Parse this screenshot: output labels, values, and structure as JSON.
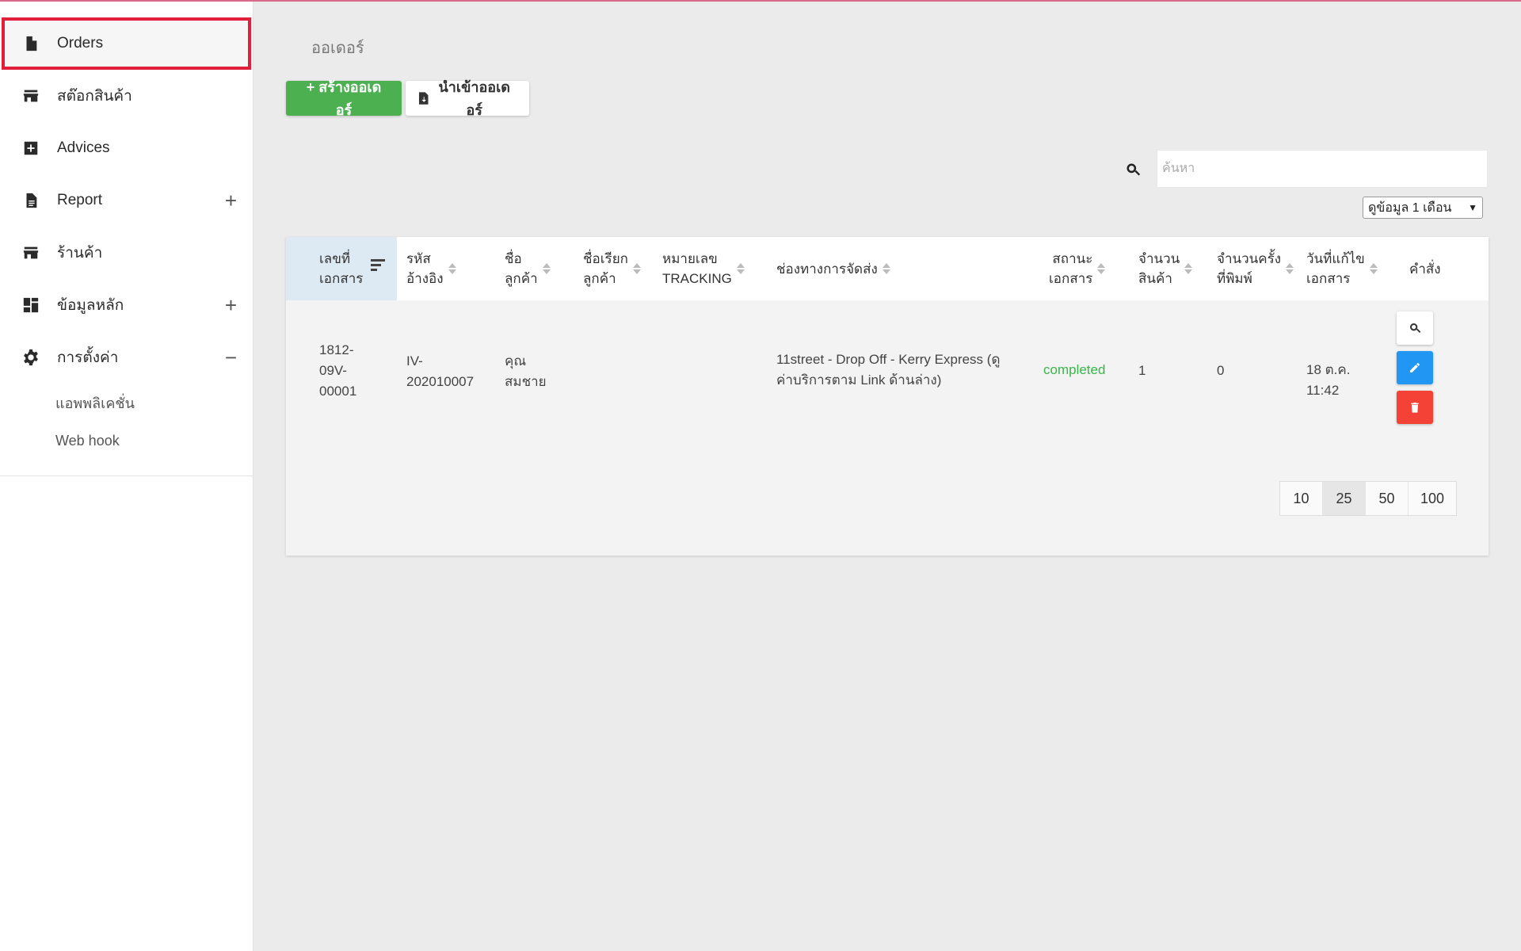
{
  "sidebar": {
    "items": [
      {
        "label": "Orders",
        "icon": "document-icon",
        "toggle": ""
      },
      {
        "label": "สต๊อกสินค้า",
        "icon": "store-icon",
        "toggle": ""
      },
      {
        "label": "Advices",
        "icon": "plus-box-icon",
        "toggle": ""
      },
      {
        "label": "Report",
        "icon": "report-icon",
        "toggle": "+"
      },
      {
        "label": "ร้านค้า",
        "icon": "store-icon",
        "toggle": ""
      },
      {
        "label": "ข้อมูลหลัก",
        "icon": "dashboard-icon",
        "toggle": "+"
      },
      {
        "label": "การตั้งค่า",
        "icon": "gear-icon",
        "toggle": "−"
      }
    ],
    "subitems": [
      {
        "label": "แอพพลิเคชั่น"
      },
      {
        "label": "Web hook"
      }
    ]
  },
  "main": {
    "title": "ออเดอร์",
    "create_button": "+ สร้างออเดอร์",
    "import_button": "นำเข้าออเดอร์",
    "search": {
      "placeholder": "ค้นหา",
      "value": ""
    },
    "range_select": "ดูข้อมูล 1 เดือน"
  },
  "table": {
    "headers": [
      "เลขที่\nเอกสาร",
      "รหัส\nอ้างอิง",
      "ชื่อ\nลูกค้า",
      "ชื่อเรียก\nลูกค้า",
      "หมายเลข\nTRACKING",
      "ช่องทางการจัดส่ง",
      "สถานะ\nเอกสาร",
      "จำนวน\nสินค้า",
      "จำนวนครั้ง\nที่พิมพ์",
      "วันที่แก้ไข\nเอกสาร",
      "คำสั่ง"
    ],
    "rows": [
      {
        "doc_no": "1812-\n09V-\n00001",
        "ref_code": "IV-\n202010007",
        "customer": "คุณ\nสมชาย",
        "nickname": "",
        "tracking": "",
        "shipping": "11street - Drop Off - Kerry Express (ดู\nค่าบริการตาม Link ด้านล่าง)",
        "status": "completed",
        "qty": "1",
        "print_count": "0",
        "modified": "18 ต.ค.\n11:42"
      }
    ],
    "page_sizes": [
      "10",
      "25",
      "50",
      "100"
    ],
    "active_page_size": "25"
  },
  "colors": {
    "create": "#4caf50",
    "edit": "#2196f3",
    "delete": "#f44336",
    "completed": "#39b54a",
    "highlight": "#e21f3a"
  }
}
